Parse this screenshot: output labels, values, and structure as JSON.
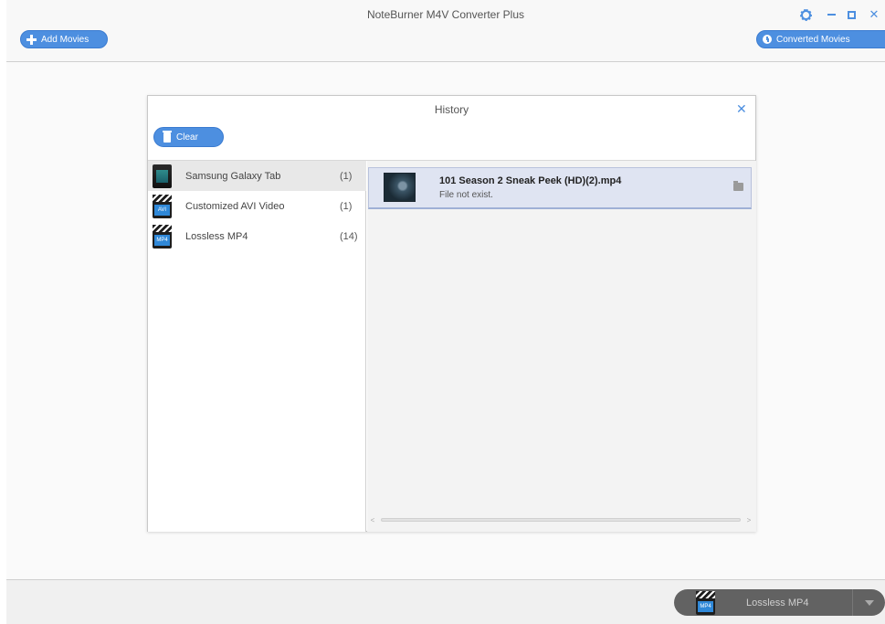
{
  "app": {
    "title": "NoteBurner M4V Converter Plus",
    "add_movies_label": "Add Movies",
    "converted_movies_label": "Converted Movies",
    "accent_color": "#4d8fe0"
  },
  "window_controls": {
    "settings_icon": "gear-icon",
    "minimize_icon": "minimize-icon",
    "maximize_icon": "maximize-icon",
    "close_glyph": "✕"
  },
  "history_dialog": {
    "title": "History",
    "close_glyph": "✕",
    "clear_label": "Clear",
    "profiles": [
      {
        "name": "Samsung Galaxy Tab",
        "count": "(1)",
        "icon": "tablet-icon",
        "selected": true
      },
      {
        "name": "Customized AVI Video",
        "count": "(1)",
        "icon": "clapper-icon",
        "badge": "AVI"
      },
      {
        "name": "Lossless MP4",
        "count": "(14)",
        "icon": "clapper-icon",
        "badge": "MP4"
      }
    ],
    "files": [
      {
        "name": "101 Season 2 Sneak Peek (HD)(2).mp4",
        "status": "File not exist.",
        "icon": "thumbnail-icon"
      }
    ],
    "scroll_left_glyph": "<",
    "scroll_right_glyph": ">"
  },
  "bottom_bar": {
    "output_format_label": "Lossless MP4",
    "output_badge": "MP4"
  }
}
